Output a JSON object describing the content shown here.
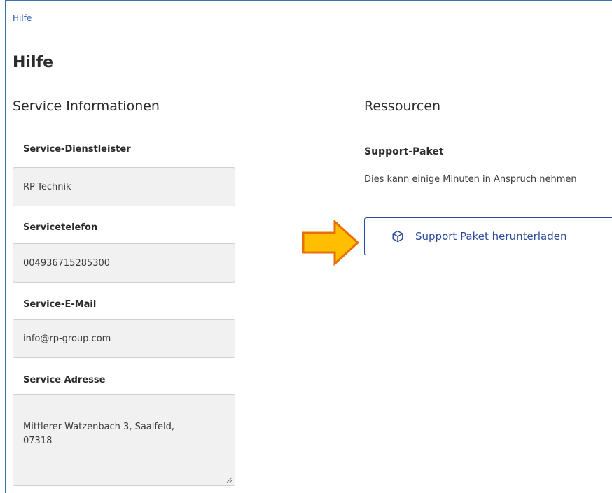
{
  "breadcrumb": {
    "label": "Hilfe"
  },
  "page": {
    "title": "Hilfe"
  },
  "service_info": {
    "title": "Service Informationen",
    "fields": [
      {
        "label": "Service-Dienstleister",
        "value": "RP-Technik"
      },
      {
        "label": "Servicetelefon",
        "value": "004936715285300"
      },
      {
        "label": "Service-E-Mail",
        "value": "info@rp-group.com"
      },
      {
        "label": "Service Adresse",
        "value": "Mittlerer Watzenbach 3, Saalfeld,\n07318"
      }
    ]
  },
  "resources": {
    "title": "Ressourcen",
    "support_package": {
      "title": "Support-Paket",
      "description": "Dies kann einige Minuten in Anspruch nehmen",
      "button_label": "Support Paket herunterladen",
      "button_icon": "package-icon"
    }
  },
  "colors": {
    "link": "#2a5aa8",
    "button_accent": "#2a4a9a",
    "field_background": "#f1f1f1",
    "arrow_fill": "#ffbf00",
    "arrow_stroke": "#e8700a"
  }
}
